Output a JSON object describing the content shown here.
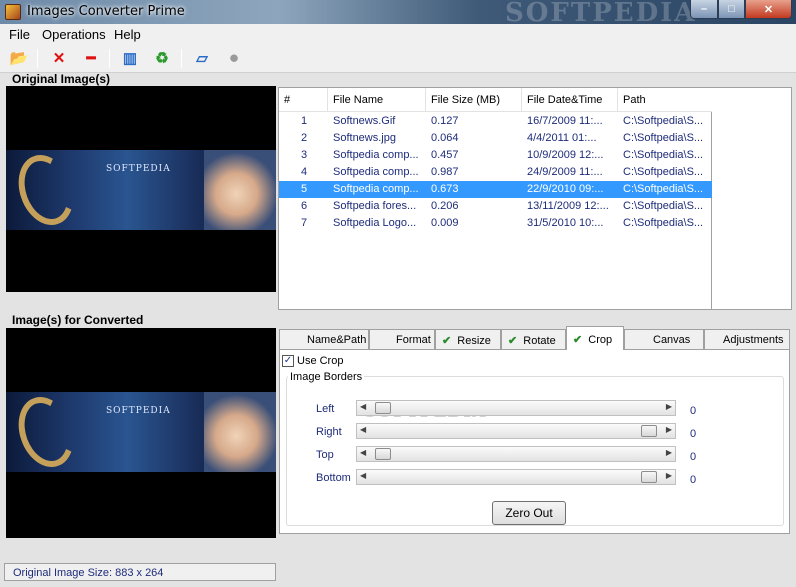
{
  "window": {
    "title": "Images Converter Prime",
    "watermark": "SOFTPEDIA",
    "minimize": "–",
    "maximize": "□",
    "close": "✕"
  },
  "menu": [
    "File",
    "Operations",
    "Help"
  ],
  "toolbar": [
    {
      "name": "open-folder-icon",
      "glyph": "📂",
      "color": "#d9a520"
    },
    {
      "name": "delete-icon",
      "glyph": "✕",
      "color": "#e01010"
    },
    {
      "name": "remove-icon",
      "glyph": "━",
      "color": "#e01010"
    },
    {
      "name": "columns-icon",
      "glyph": "▥",
      "color": "#2a6cc8"
    },
    {
      "name": "convert-icon",
      "glyph": "♻",
      "color": "#2a9a2a"
    },
    {
      "name": "layers-icon",
      "glyph": "▱",
      "color": "#2a6cc8"
    },
    {
      "name": "stop-icon",
      "glyph": "⏺",
      "color": "#9a9a9a"
    }
  ],
  "original_label": "Original Image(s)",
  "converted_label": "Image(s) for Converted",
  "banner_text": "SOFTPEDIA",
  "table": {
    "columns": [
      "#",
      "File Name",
      "File Size (MB)",
      "File Date&Time",
      "Path"
    ],
    "rows": [
      [
        "1",
        "Softnews.Gif",
        "0.127",
        "16/7/2009 11:...",
        "C:\\Softpedia\\S..."
      ],
      [
        "2",
        "Softnews.jpg",
        "0.064",
        "4/4/2011 01:...",
        "C:\\Softpedia\\S..."
      ],
      [
        "3",
        "Softpedia comp...",
        "0.457",
        "10/9/2009 12:...",
        "C:\\Softpedia\\S..."
      ],
      [
        "4",
        "Softpedia comp...",
        "0.987",
        "24/9/2009 11:...",
        "C:\\Softpedia\\S..."
      ],
      [
        "5",
        "Softpedia comp...",
        "0.673",
        "22/9/2010 09:...",
        "C:\\Softpedia\\S..."
      ],
      [
        "6",
        "Softpedia fores...",
        "0.206",
        "13/11/2009 12:...",
        "C:\\Softpedia\\S..."
      ],
      [
        "7",
        "Softpedia Logo...",
        "0.009",
        "31/5/2010 10:...",
        "C:\\Softpedia\\S..."
      ]
    ],
    "selected_row": 5
  },
  "tabs": [
    {
      "label": "Name&Path",
      "checked": false
    },
    {
      "label": "Format",
      "checked": false
    },
    {
      "label": "Resize",
      "checked": true
    },
    {
      "label": "Rotate",
      "checked": true
    },
    {
      "label": "Crop",
      "checked": true,
      "active": true
    },
    {
      "label": "Canvas",
      "checked": false
    },
    {
      "label": "Adjustments",
      "checked": false
    }
  ],
  "crop": {
    "use_crop_label": "Use Crop",
    "use_crop_checked": true,
    "borders_label": "Image Borders",
    "sliders": [
      {
        "label": "Left",
        "value": "0",
        "level": 0.02
      },
      {
        "label": "Right",
        "value": "0",
        "level": 0.98
      },
      {
        "label": "Top",
        "value": "0",
        "level": 0.02
      },
      {
        "label": "Bottom",
        "value": "0",
        "level": 0.98
      }
    ],
    "zero_out_label": "Zero Out"
  },
  "status": {
    "text": "Original Image Size: 883 x 264"
  }
}
